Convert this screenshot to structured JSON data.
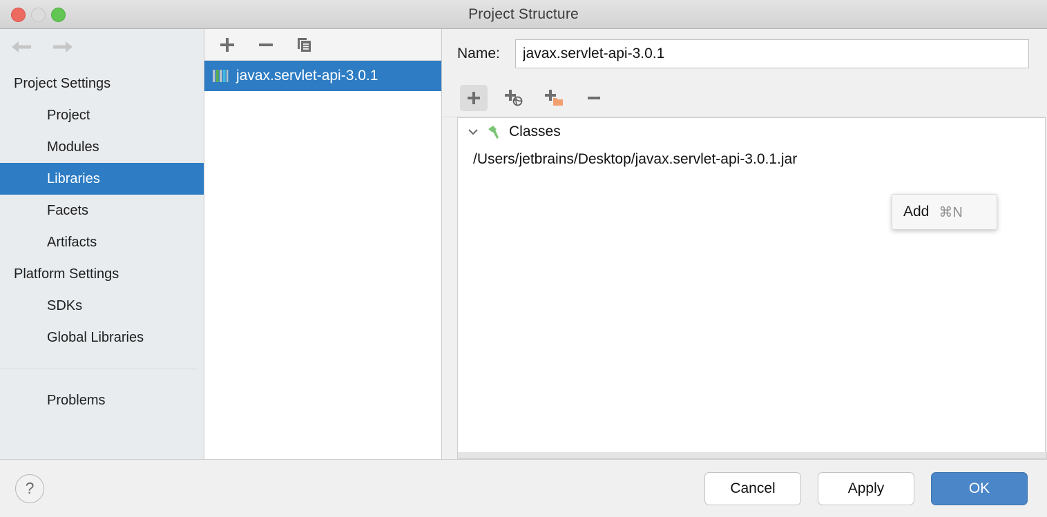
{
  "window": {
    "title": "Project Structure",
    "traffic_lights": [
      "close",
      "minimize",
      "maximize"
    ],
    "colors": {
      "selection_blue": "#2d7cc4",
      "primary_button_blue": "#4a86c8",
      "sidebar_bg": "#e8ecef",
      "hammer_green": "#7cc576",
      "folder_orange": "#f2a070"
    }
  },
  "navigation": {
    "back_label": "Back",
    "forward_label": "Forward"
  },
  "sidebar": {
    "sections": [
      {
        "group": "Project Settings",
        "items": [
          {
            "label": "Project",
            "selected": false
          },
          {
            "label": "Modules",
            "selected": false
          },
          {
            "label": "Libraries",
            "selected": true
          },
          {
            "label": "Facets",
            "selected": false
          },
          {
            "label": "Artifacts",
            "selected": false
          }
        ]
      },
      {
        "group": "Platform Settings",
        "items": [
          {
            "label": "SDKs",
            "selected": false
          },
          {
            "label": "Global Libraries",
            "selected": false
          }
        ]
      }
    ],
    "extra_item": {
      "label": "Problems",
      "selected": false
    }
  },
  "library_list": {
    "toolbar": [
      {
        "name": "add",
        "glyph": "plus-icon"
      },
      {
        "name": "remove",
        "glyph": "minus-icon"
      },
      {
        "name": "copy",
        "glyph": "copy-icon"
      }
    ],
    "rows": [
      {
        "label": "javax.servlet-api-3.0.1",
        "icon": "library-icon",
        "selected": true
      }
    ]
  },
  "detail": {
    "name_label": "Name:",
    "name_value": "javax.servlet-api-3.0.1",
    "name_placeholder": "",
    "toolbar": [
      {
        "name": "add-root",
        "glyph": "plus-icon",
        "pressed": true
      },
      {
        "name": "add-web-root",
        "glyph": "plus-globe-icon",
        "pressed": false
      },
      {
        "name": "add-jar-directory",
        "glyph": "plus-folder-icon",
        "pressed": false
      },
      {
        "name": "remove-root",
        "glyph": "minus-icon",
        "pressed": false
      }
    ],
    "tree": {
      "root_label": "Classes",
      "root_icon": "hammer-icon",
      "expanded": true,
      "children": [
        {
          "path": "/Users/jetbrains/Desktop/javax.servlet-api-3.0.1.jar"
        }
      ]
    }
  },
  "popup_menu": {
    "items": [
      {
        "label": "Add",
        "shortcut": "⌘N"
      }
    ]
  },
  "footer": {
    "help_label": "?",
    "buttons": [
      {
        "label": "Cancel",
        "primary": false
      },
      {
        "label": "Apply",
        "primary": false
      },
      {
        "label": "OK",
        "primary": true
      }
    ]
  }
}
